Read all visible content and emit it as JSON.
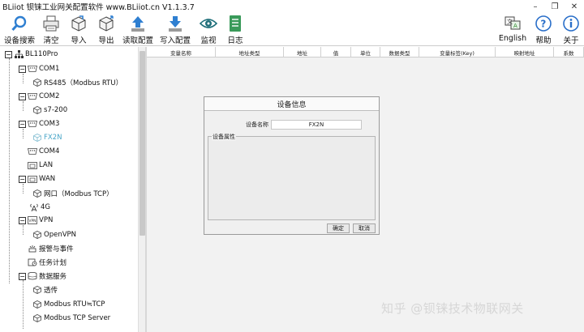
{
  "window": {
    "title": "BLiiot 钡铼工业网关配置软件 www.BLiiot.cn V1.1.3.7",
    "controls": [
      "–",
      "❐",
      "✕"
    ]
  },
  "toolbar": {
    "buttons": [
      {
        "label": "设备搜索",
        "icon": "magnifier-icon"
      },
      {
        "label": "清空",
        "icon": "printer-icon"
      },
      {
        "label": "导入",
        "icon": "cube-import-icon"
      },
      {
        "label": "导出",
        "icon": "cube-export-icon"
      },
      {
        "label": "读取配置",
        "icon": "upload-arrow-icon"
      },
      {
        "label": "写入配置",
        "icon": "download-arrow-icon"
      },
      {
        "label": "监视",
        "icon": "eye-icon"
      },
      {
        "label": "日志",
        "icon": "document-icon"
      },
      {
        "label": "English",
        "icon": "language-icon"
      },
      {
        "label": "帮助",
        "icon": "help-icon"
      },
      {
        "label": "关于",
        "icon": "info-icon"
      }
    ]
  },
  "tree": {
    "items": [
      {
        "label": "BL110Pro",
        "icon": "network-icon"
      },
      {
        "label": "COM1",
        "icon": "serial-port-icon"
      },
      {
        "label": "RS485（Modbus RTU）",
        "icon": "device-cube-icon"
      },
      {
        "label": "COM2",
        "icon": "serial-port-icon"
      },
      {
        "label": "s7-200",
        "icon": "device-cube-icon"
      },
      {
        "label": "COM3",
        "icon": "serial-port-icon"
      },
      {
        "label": "FX2N",
        "icon": "device-cube-icon"
      },
      {
        "label": "COM4",
        "icon": "serial-port-icon"
      },
      {
        "label": "LAN",
        "icon": "lan-port-icon"
      },
      {
        "label": "WAN",
        "icon": "wan-port-icon"
      },
      {
        "label": "网口（Modbus TCP）",
        "icon": "device-cube-icon"
      },
      {
        "label": "4G",
        "icon": "antenna-icon"
      },
      {
        "label": "VPN",
        "icon": "vpn-icon"
      },
      {
        "label": "OpenVPN",
        "icon": "device-cube-icon"
      },
      {
        "label": "报警与事件",
        "icon": "alarm-icon"
      },
      {
        "label": "任务计划",
        "icon": "schedule-icon"
      },
      {
        "label": "数据服务",
        "icon": "database-icon"
      },
      {
        "label": "透传",
        "icon": "device-cube-icon"
      },
      {
        "label": "Modbus RTU≒TCP",
        "icon": "device-cube-icon"
      },
      {
        "label": "Modbus TCP Server",
        "icon": "device-cube-icon"
      }
    ]
  },
  "table": {
    "columns": [
      "变量名称",
      "地址类型",
      "地址",
      "值",
      "单位",
      "数据类型",
      "变量标签(Key)",
      "映射地址",
      "系数"
    ]
  },
  "dialog": {
    "title": "设备信息",
    "name_label": "设备名称",
    "name_value": "FX2N",
    "group_label": "设备属性",
    "ok_label": "确定",
    "cancel_label": "取消"
  },
  "watermark": "知乎 @钡铼技术物联网关",
  "colors": {
    "selected_text": "#48a6c8",
    "accent_blue": "#2f7fd1",
    "help_blue": "#2a6fc9"
  }
}
